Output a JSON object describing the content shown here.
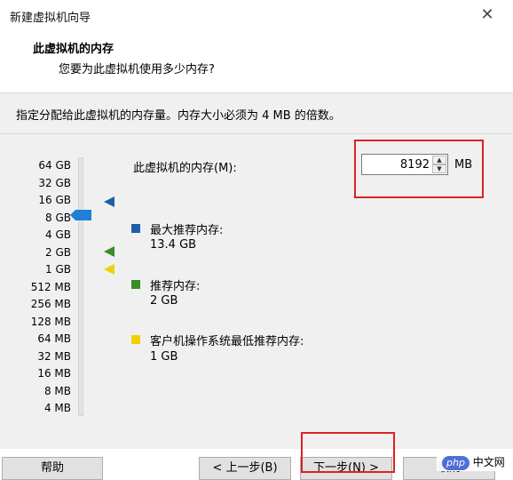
{
  "window": {
    "title": "新建虚拟机向导",
    "close_glyph": "✕"
  },
  "header": {
    "title": "此虚拟机的内存",
    "subtitle": "您要为此虚拟机使用多少内存?"
  },
  "instruction": "指定分配给此虚拟机的内存量。内存大小必须为 4 MB 的倍数。",
  "scale_labels": [
    "64 GB",
    "32 GB",
    "16 GB",
    "8 GB",
    "4 GB",
    "2 GB",
    "1 GB",
    "512 MB",
    "256 MB",
    "128 MB",
    "64 MB",
    "32 MB",
    "16 MB",
    "8 MB",
    "4 MB"
  ],
  "memory": {
    "label": "此虚拟机的内存(M):",
    "value": "8192",
    "unit": "MB",
    "selected_level": "8 GB"
  },
  "legend": [
    {
      "title": "最大推荐内存:",
      "value": "13.4 GB",
      "color": "#1f5fa8",
      "marker_level": "16 GB"
    },
    {
      "title": "推荐内存:",
      "value": "2 GB",
      "color": "#3a8c27",
      "marker_level": "2 GB"
    },
    {
      "title": "客户机操作系统最低推荐内存:",
      "value": "1 GB",
      "color": "#f0d000",
      "marker_level": "1 GB"
    }
  ],
  "buttons": {
    "help": "帮助",
    "back": "< 上一步(B)",
    "next": "下一步(N) >",
    "cancel": "取消"
  },
  "watermark": {
    "brand": "php",
    "text": "中文网"
  },
  "colors": {
    "highlight": "#e02020",
    "thumb": "#1f80d6"
  }
}
